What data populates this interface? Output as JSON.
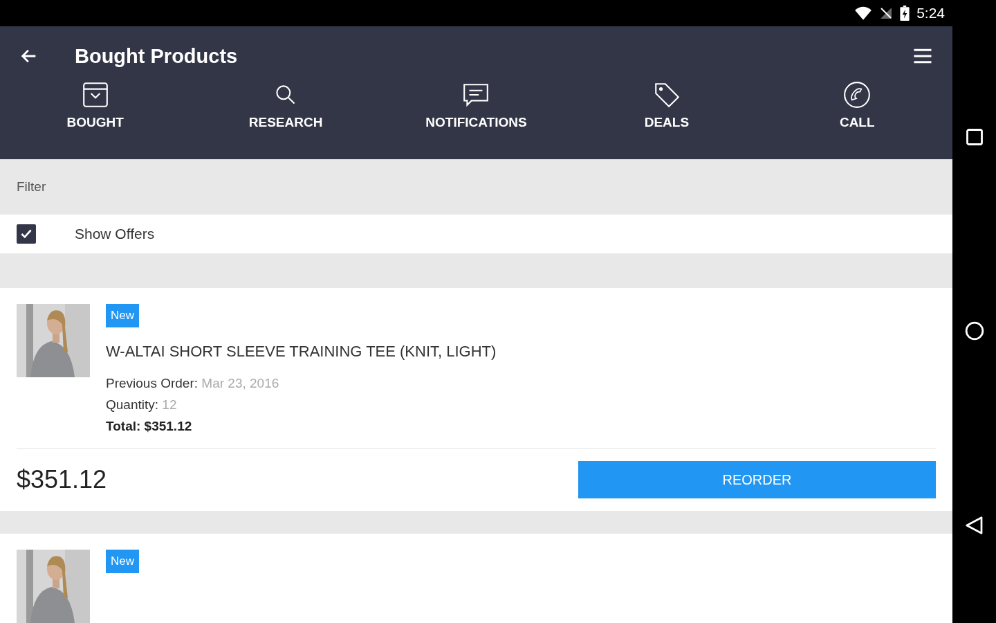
{
  "status_bar": {
    "time": "5:24"
  },
  "app_bar": {
    "title": "Bought Products"
  },
  "tabs": [
    {
      "label": "BOUGHT"
    },
    {
      "label": "RESEARCH"
    },
    {
      "label": "NOTIFICATIONS"
    },
    {
      "label": "DEALS"
    },
    {
      "label": "CALL"
    }
  ],
  "filter": {
    "heading": "Filter",
    "show_offers": {
      "label": "Show Offers",
      "checked": true
    }
  },
  "products": [
    {
      "badge": "New",
      "title": "W-ALTAI SHORT SLEEVE TRAINING TEE (KNIT, LIGHT)",
      "details": [
        {
          "label": "Previous Order:",
          "value": "Mar 23, 2016"
        },
        {
          "label": "Quantity:",
          "value": "12"
        }
      ],
      "total": "Total: $351.12",
      "price": "$351.12",
      "button": "REORDER"
    },
    {
      "badge": "New"
    }
  ]
}
